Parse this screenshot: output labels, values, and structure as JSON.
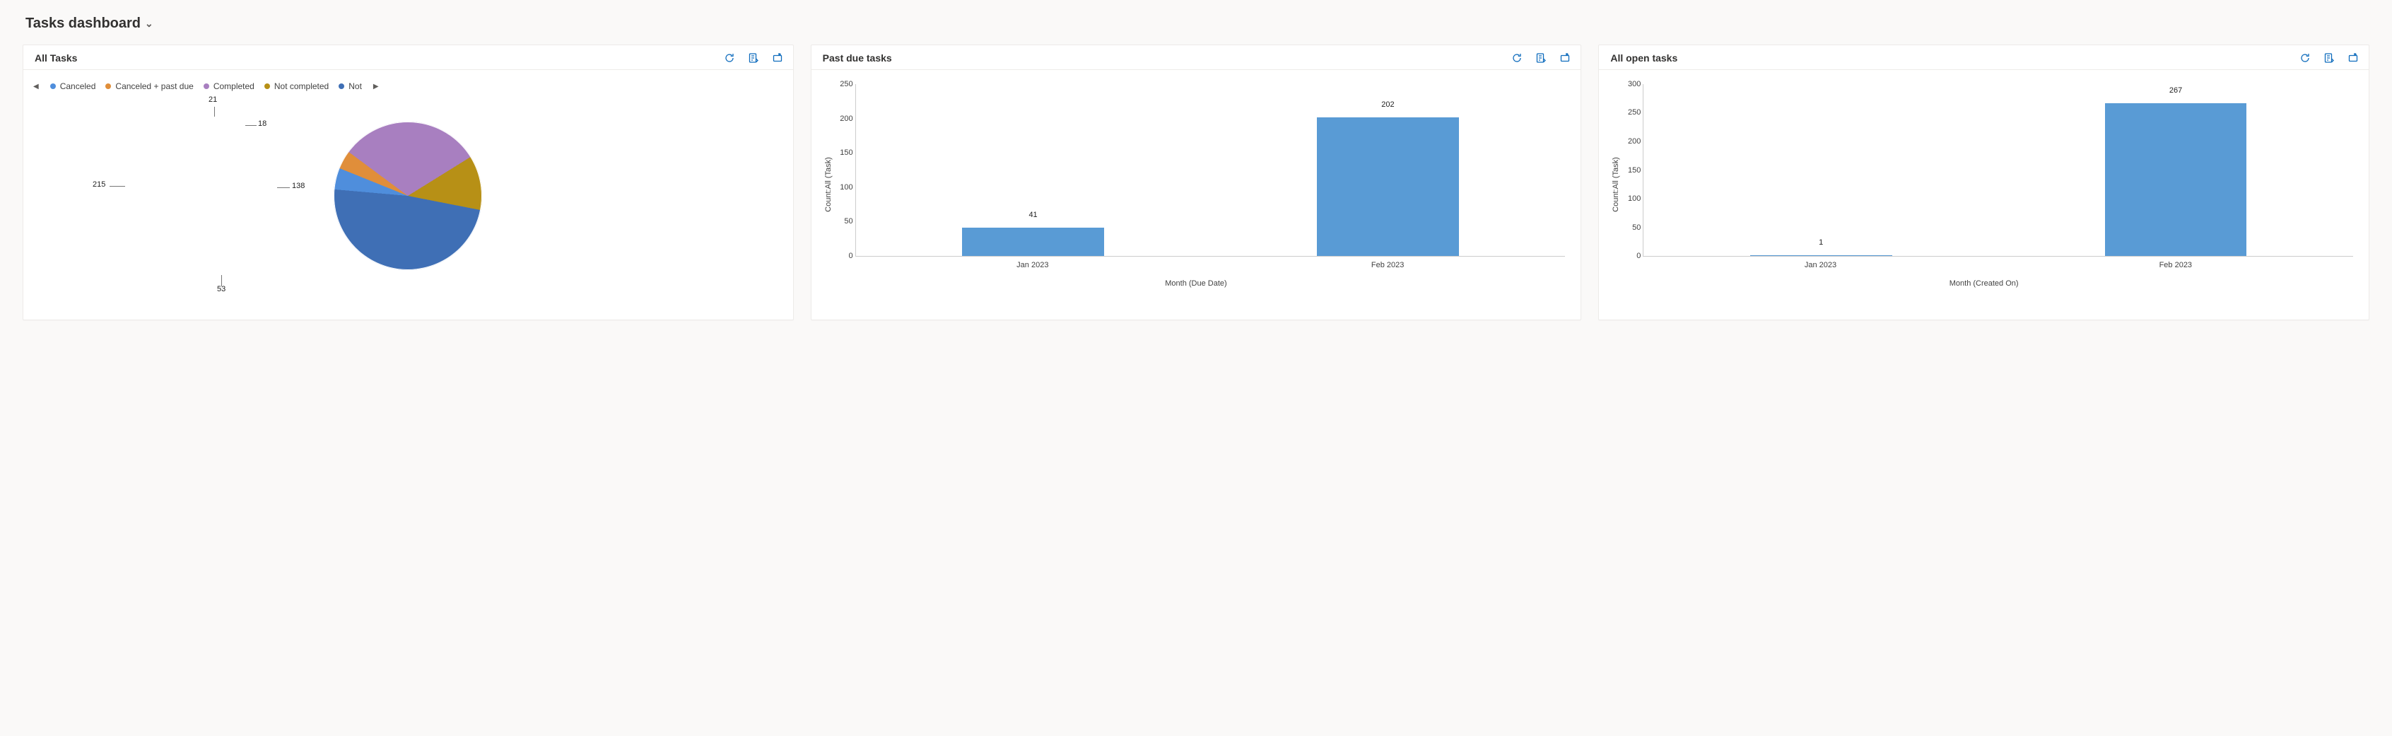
{
  "page_title": "Tasks dashboard",
  "cards": {
    "all_tasks": {
      "title": "All Tasks",
      "legend": {
        "items": [
          {
            "label": "Canceled",
            "color": "#4f8edc"
          },
          {
            "label": "Canceled + past due",
            "color": "#e08e3a"
          },
          {
            "label": "Completed",
            "color": "#a87fc0"
          },
          {
            "label": "Not completed",
            "color": "#b79016"
          },
          {
            "label": "Not",
            "color": "#3f6fb5"
          }
        ]
      }
    },
    "past_due": {
      "title": "Past due tasks",
      "ylabel": "Count:All (Task)",
      "xlabel": "Month (Due Date)"
    },
    "all_open": {
      "title": "All open tasks",
      "ylabel": "Count:All (Task)",
      "xlabel": "Month (Created On)"
    }
  },
  "chart_data": [
    {
      "id": "all_tasks_pie",
      "type": "pie",
      "title": "All Tasks",
      "series": [
        {
          "name": "Canceled",
          "value": 21,
          "color": "#4f8edc"
        },
        {
          "name": "Canceled + past due",
          "value": 18,
          "color": "#e08e3a"
        },
        {
          "name": "Completed",
          "value": 138,
          "color": "#a87fc0"
        },
        {
          "name": "Not completed",
          "value": 53,
          "color": "#b79016"
        },
        {
          "name": "Not",
          "value": 215,
          "color": "#3f6fb5"
        }
      ]
    },
    {
      "id": "past_due_bar",
      "type": "bar",
      "title": "Past due tasks",
      "categories": [
        "Jan 2023",
        "Feb 2023"
      ],
      "values": [
        41,
        202
      ],
      "ylabel": "Count:All (Task)",
      "xlabel": "Month (Due Date)",
      "ylim": [
        0,
        250
      ],
      "yticks": [
        0,
        50,
        100,
        150,
        200,
        250
      ]
    },
    {
      "id": "all_open_bar",
      "type": "bar",
      "title": "All open tasks",
      "categories": [
        "Jan 2023",
        "Feb 2023"
      ],
      "values": [
        1,
        267
      ],
      "ylabel": "Count:All (Task)",
      "xlabel": "Month (Created On)",
      "ylim": [
        0,
        300
      ],
      "yticks": [
        0,
        50,
        100,
        150,
        200,
        250,
        300
      ]
    }
  ]
}
